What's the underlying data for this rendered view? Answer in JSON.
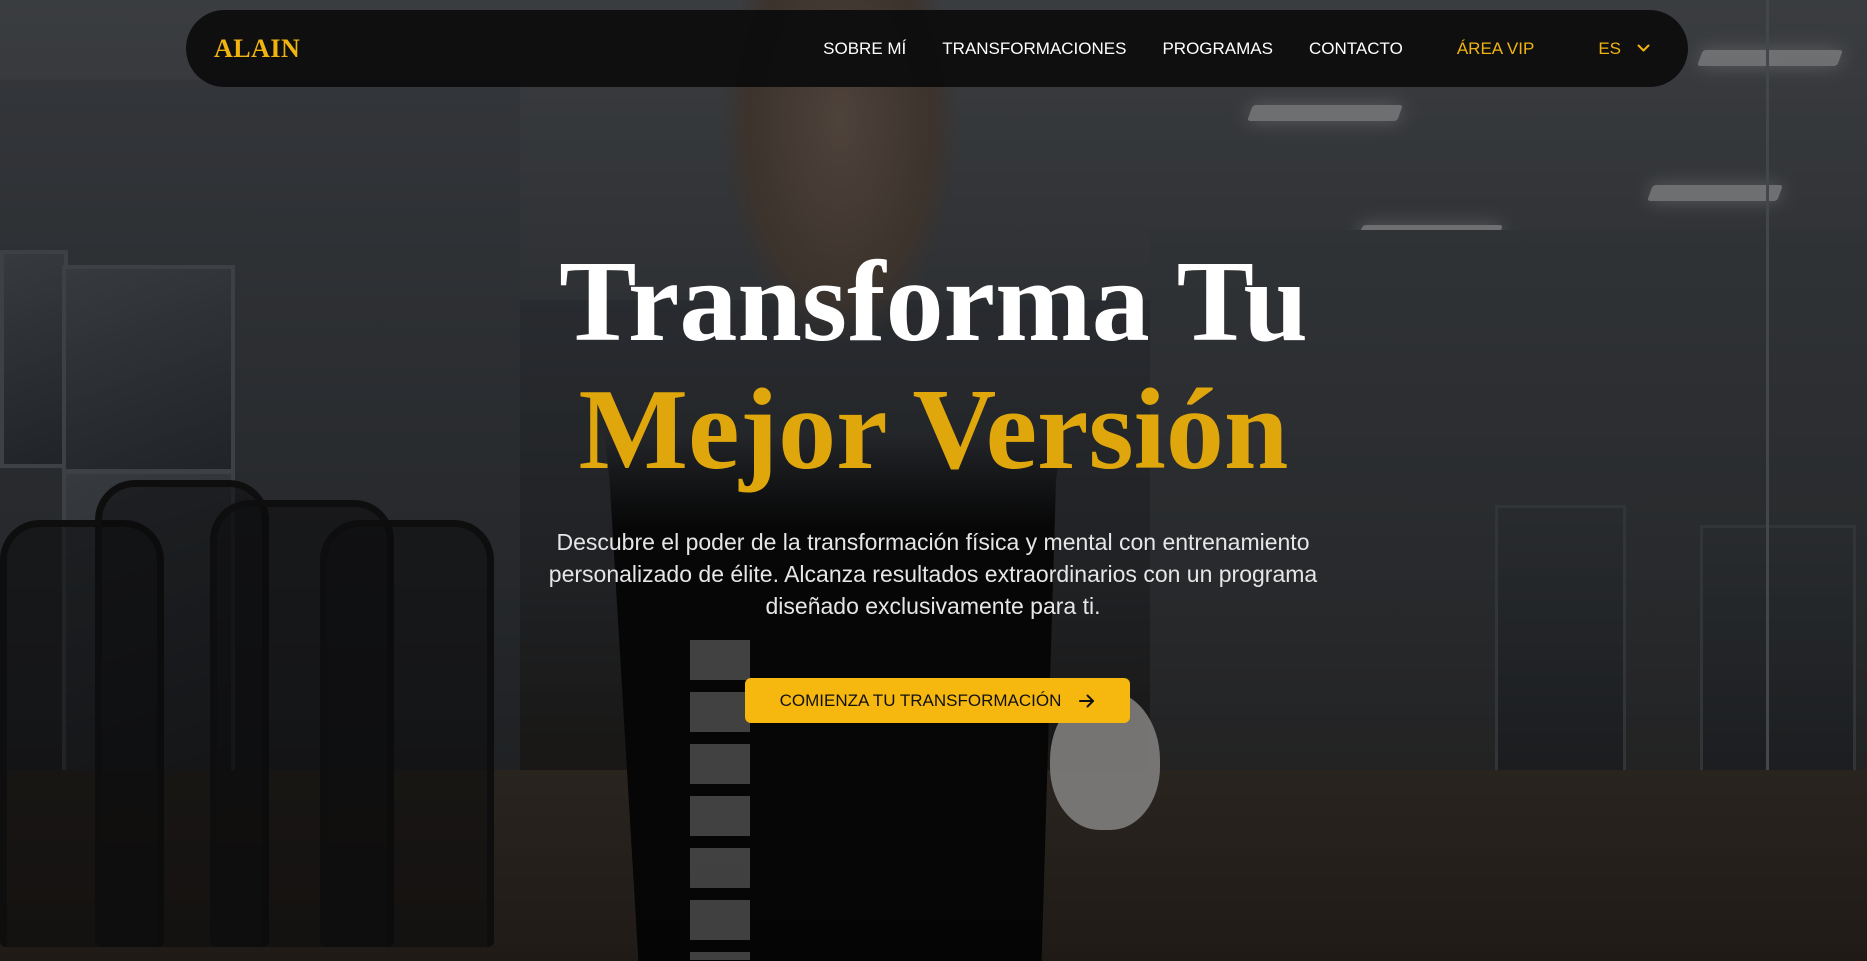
{
  "nav": {
    "logo": "ALAIN",
    "links": [
      {
        "label": "SOBRE MÍ"
      },
      {
        "label": "TRANSFORMACIONES"
      },
      {
        "label": "PROGRAMAS"
      },
      {
        "label": "CONTACTO"
      }
    ],
    "vip_label": "ÁREA VIP",
    "language": "ES",
    "language_icon": "chevron-down-icon"
  },
  "hero": {
    "title_line1": "Transforma Tu",
    "title_line2": "Mejor Versión",
    "description": "Descubre el poder de la transformación física y mental con entrenamiento personalizado de élite. Alcanza resultados extraordinarios con un programa diseñado exclusivamente para ti.",
    "cta_label": "COMIENZA TU TRANSFORMACIÓN",
    "cta_icon": "arrow-right-icon"
  },
  "colors": {
    "accent": "#f1b40f",
    "navbar_bg": "#0c0c0d",
    "title_white": "#ffffff",
    "title_gold": "#e0a70c"
  }
}
